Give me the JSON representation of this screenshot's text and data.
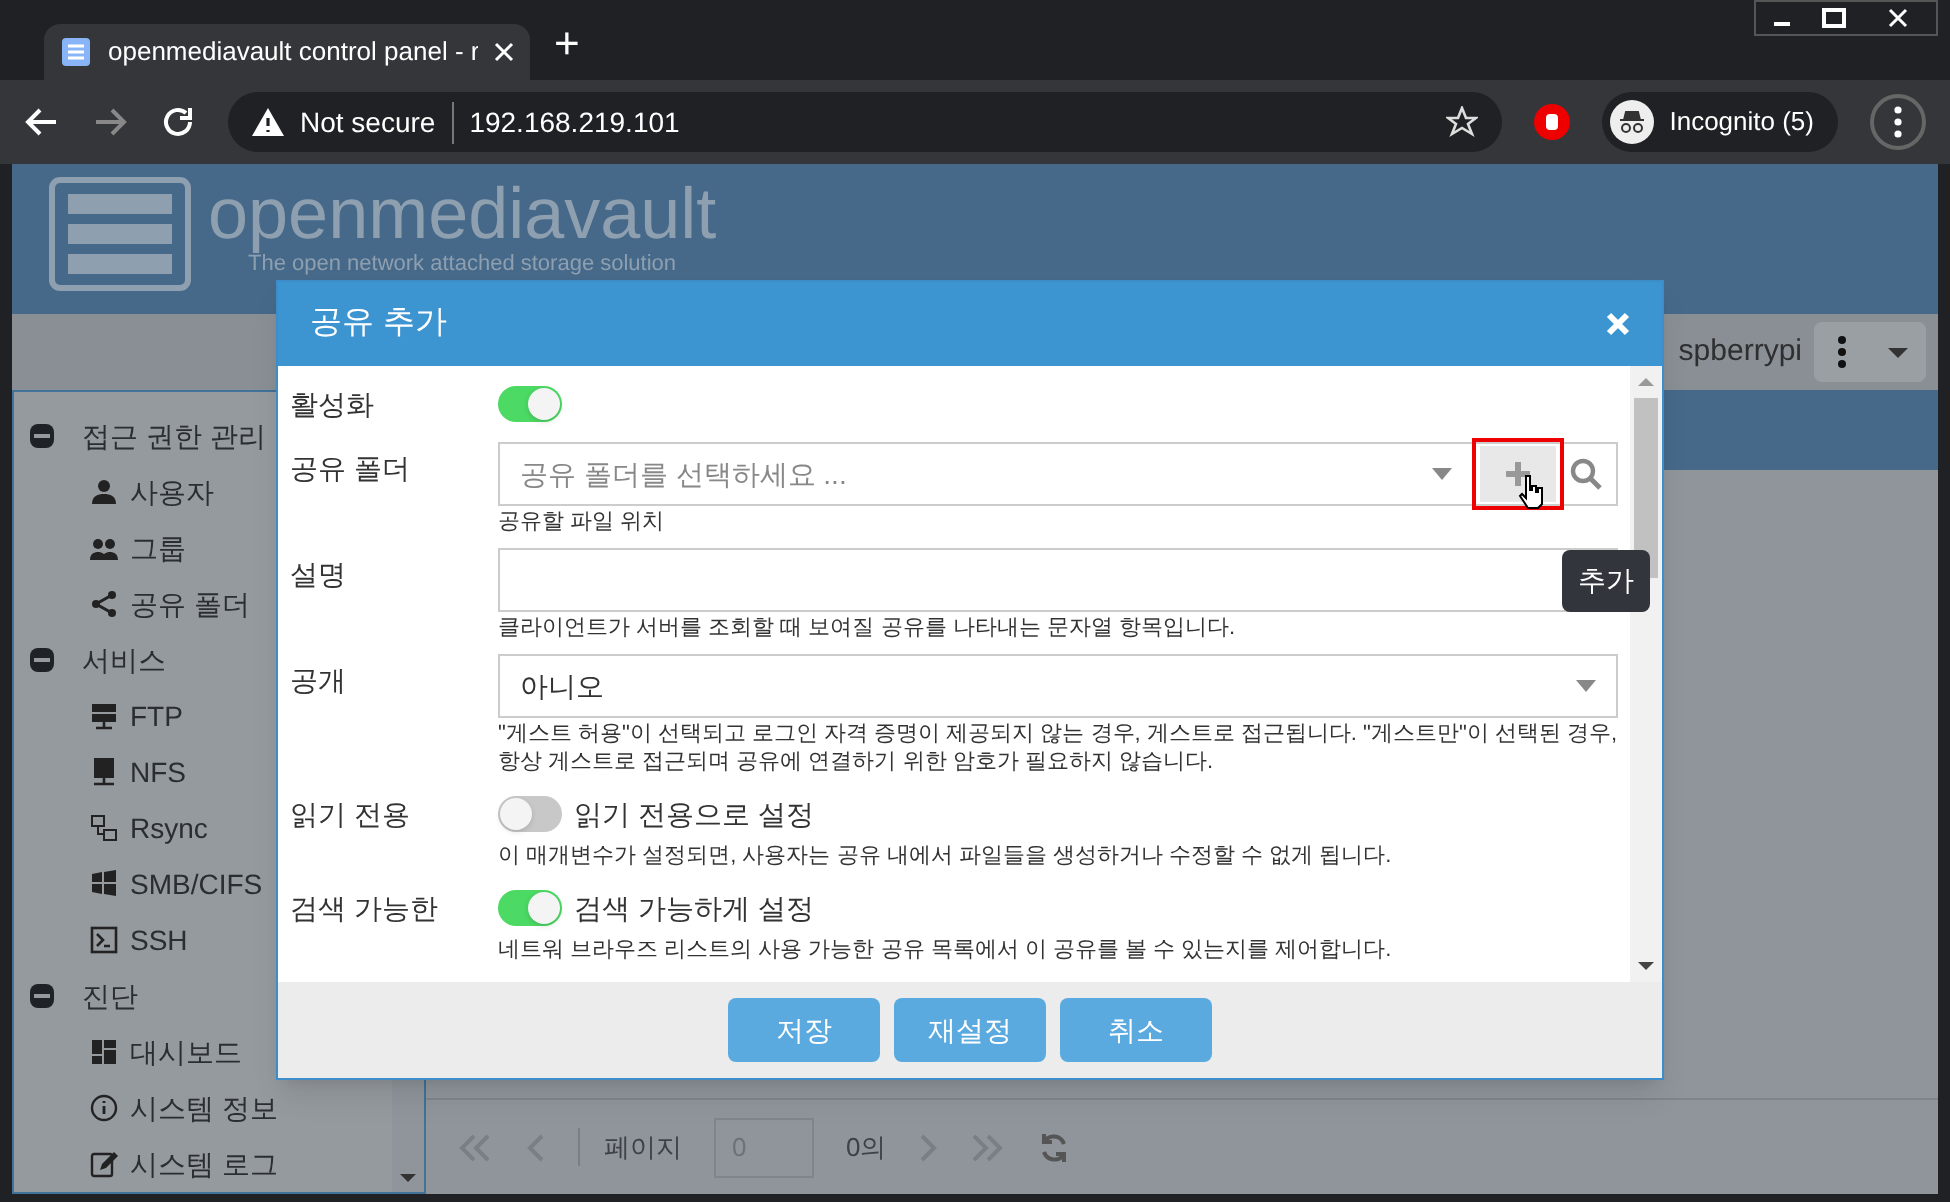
{
  "browser": {
    "tab_title": "openmediavault control panel - r",
    "new_tab": "+",
    "security": "Not secure",
    "url": "192.168.219.101",
    "profile": "Incognito (5)"
  },
  "app": {
    "logo": "openmediavault",
    "tagline": "The open network attached storage solution",
    "host": "spberrypi"
  },
  "sidebar": [
    {
      "label": "접근 권한 관리",
      "expanded": true,
      "children": [
        {
          "label": "사용자"
        },
        {
          "label": "그룹"
        },
        {
          "label": "공유 폴더"
        }
      ]
    },
    {
      "label": "서비스",
      "expanded": true,
      "children": [
        {
          "label": "FTP"
        },
        {
          "label": "NFS"
        },
        {
          "label": "Rsync"
        },
        {
          "label": "SMB/CIFS"
        },
        {
          "label": "SSH"
        }
      ]
    },
    {
      "label": "진단",
      "expanded": true,
      "children": [
        {
          "label": "대시보드"
        },
        {
          "label": "시스템 정보"
        },
        {
          "label": "시스템 로그"
        }
      ]
    }
  ],
  "pager": {
    "label": "페이지",
    "page": "0",
    "of": "0의"
  },
  "dialog": {
    "title": "공유 추가",
    "fields": [
      {
        "kind": "toggle",
        "label": "활성화",
        "on": true
      },
      {
        "kind": "combo",
        "label": "공유 폴더",
        "placeholder": "공유 폴더를 선택하세요 ...",
        "hint": "공유할 파일 위치"
      },
      {
        "kind": "text",
        "label": "설명",
        "hint": "클라이언트가 서버를 조회할 때 보여질 공유를 나타내는 문자열 항목입니다."
      },
      {
        "kind": "select",
        "label": "공개",
        "value": "아니오",
        "hint": "\"게스트 허용\"이 선택되고 로그인 자격 증명이 제공되지 않는 경우, 게스트로 접근됩니다. \"게스트만\"이 선택된 경우, 항상 게스트로 접근되며 공유에 연결하기 위한 암호가 필요하지 않습니다."
      },
      {
        "kind": "toggle",
        "label": "읽기 전용",
        "on": false,
        "caption": "읽기 전용으로 설정",
        "hint": "이 매개변수가 설정되면, 사용자는 공유 내에서 파일들을 생성하거나 수정할 수 없게 됩니다."
      },
      {
        "kind": "toggle",
        "label": "검색 가능한",
        "on": true,
        "caption": "검색 가능하게 설정",
        "hint": "네트워 브라우즈 리스트의 사용 가능한 공유 목록에서 이 공유를 볼 수 있는지를 제어합니다."
      }
    ],
    "tooltip": "추가",
    "buttons": [
      "저장",
      "재설정",
      "취소"
    ]
  }
}
